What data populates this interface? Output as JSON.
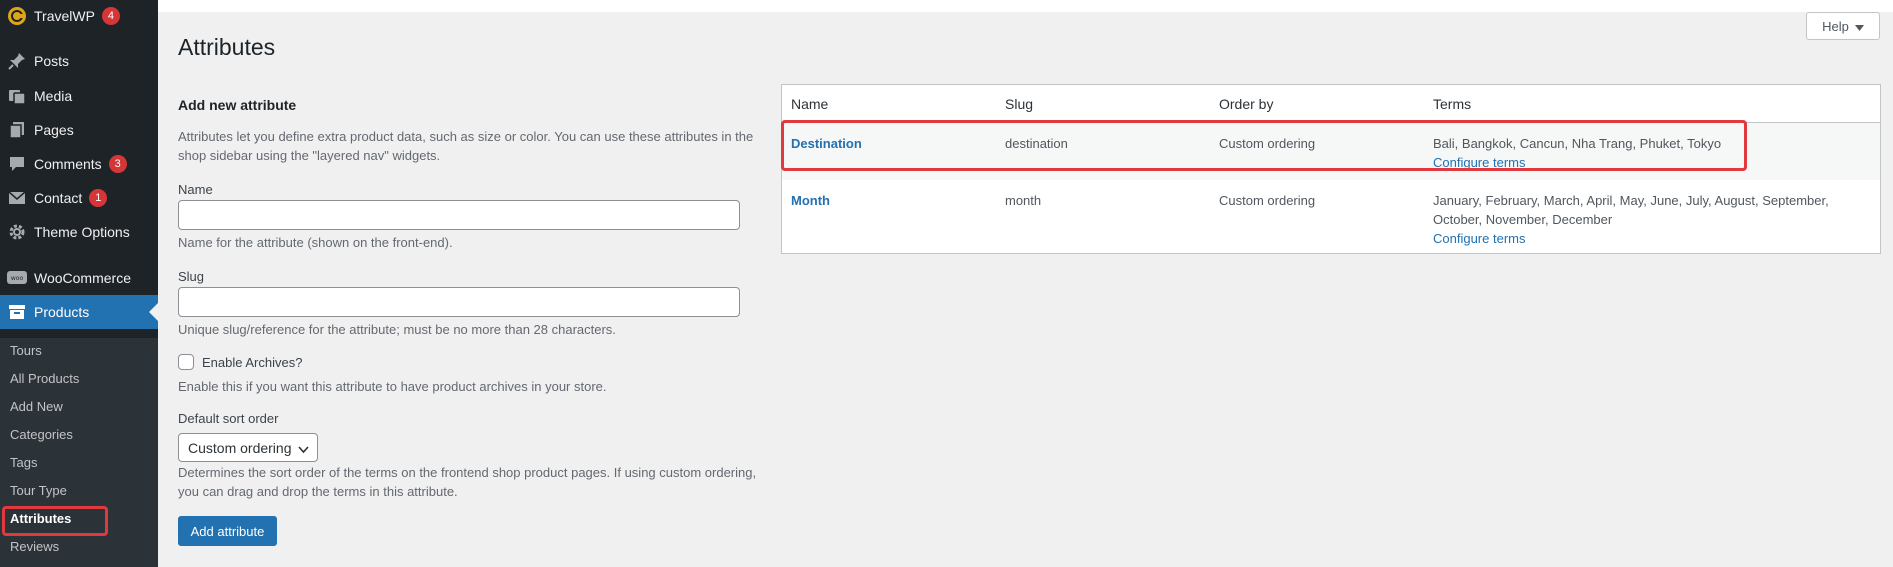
{
  "sidebar": {
    "site_name": "TravelWP",
    "site_badge": "4",
    "items": [
      {
        "label": "Posts",
        "icon": "pin-icon"
      },
      {
        "label": "Media",
        "icon": "media-icon"
      },
      {
        "label": "Pages",
        "icon": "pages-icon"
      },
      {
        "label": "Comments",
        "icon": "comment-icon",
        "badge": "3"
      },
      {
        "label": "Contact",
        "icon": "mail-icon",
        "badge": "1"
      },
      {
        "label": "Theme Options",
        "icon": "gear-icon"
      },
      {
        "label": "WooCommerce",
        "icon": "woo-icon"
      },
      {
        "label": "Products",
        "icon": "archive-icon"
      }
    ],
    "submenu": [
      "Tours",
      "All Products",
      "Add New",
      "Categories",
      "Tags",
      "Tour Type",
      "Attributes",
      "Reviews"
    ]
  },
  "help_label": "Help",
  "page_title": "Attributes",
  "form": {
    "title": "Add new attribute",
    "intro": "Attributes let you define extra product data, such as size or color. You can use these attributes in the shop sidebar using the \"layered nav\" widgets.",
    "name_label": "Name",
    "name_value": "",
    "name_desc": "Name for the attribute (shown on the front-end).",
    "slug_label": "Slug",
    "slug_value": "",
    "slug_desc": "Unique slug/reference for the attribute; must be no more than 28 characters.",
    "archives_label": "Enable Archives?",
    "archives_checked": false,
    "archives_desc": "Enable this if you want this attribute to have product archives in your store.",
    "sort_label": "Default sort order",
    "sort_value": "Custom ordering",
    "sort_desc": "Determines the sort order of the terms on the frontend shop product pages. If using custom ordering, you can drag and drop the terms in this attribute.",
    "submit_label": "Add attribute"
  },
  "table": {
    "headers": [
      "Name",
      "Slug",
      "Order by",
      "Terms"
    ],
    "rows": [
      {
        "name": "Destination",
        "slug": "destination",
        "order": "Custom ordering",
        "terms": "Bali, Bangkok, Cancun, Nha Trang, Phuket, Tokyo",
        "configure": "Configure terms"
      },
      {
        "name": "Month",
        "slug": "month",
        "order": "Custom ordering",
        "terms_line1": "January, February, March, April, May, June, July, August, September,",
        "terms_line2": "October, November, December",
        "configure": "Configure terms"
      }
    ]
  },
  "colors": {
    "accent": "#2271b1",
    "sidebar_bg": "#1d2327",
    "highlight": "#e03a3e"
  }
}
